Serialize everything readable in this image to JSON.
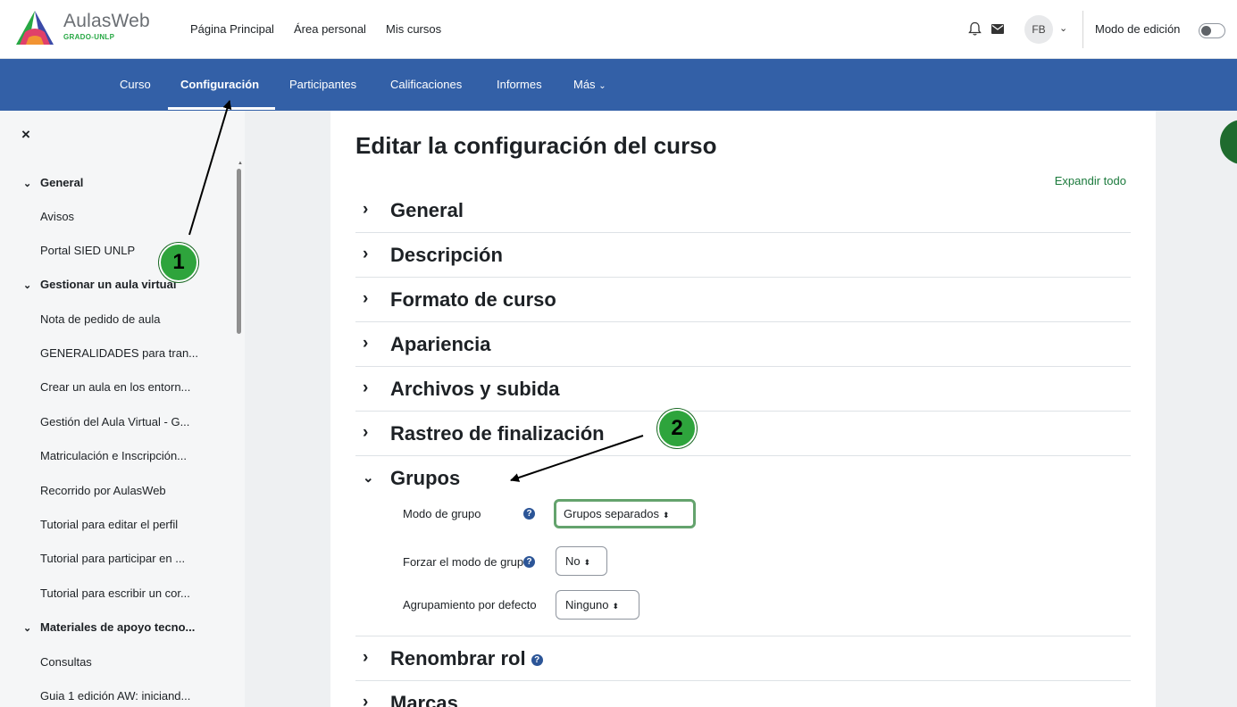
{
  "brand": {
    "name": "AulasWeb",
    "subtitle": "GRADO-UNLP"
  },
  "topnav": {
    "links": [
      "Página Principal",
      "Área personal",
      "Mis cursos"
    ]
  },
  "user": {
    "initials": "FB",
    "edit_mode_label": "Modo de edición",
    "edit_mode_on": false
  },
  "tabs": [
    "Curso",
    "Configuración",
    "Participantes",
    "Calificaciones",
    "Informes",
    "Más"
  ],
  "active_tab": "Configuración",
  "drawer": {
    "close": "×",
    "items": [
      {
        "type": "heading",
        "label": "General"
      },
      {
        "type": "item",
        "label": "Avisos"
      },
      {
        "type": "item",
        "label": "Portal SIED UNLP"
      },
      {
        "type": "heading",
        "label": "Gestionar un aula virtual"
      },
      {
        "type": "item",
        "label": "Nota de pedido de aula"
      },
      {
        "type": "item",
        "label": "GENERALIDADES para tran..."
      },
      {
        "type": "item",
        "label": "Crear un aula en los entorn..."
      },
      {
        "type": "item",
        "label": "Gestión del Aula Virtual - G..."
      },
      {
        "type": "item",
        "label": "Matriculación e Inscripción..."
      },
      {
        "type": "item",
        "label": "Recorrido por AulasWeb"
      },
      {
        "type": "item",
        "label": "Tutorial para editar el perfil"
      },
      {
        "type": "item",
        "label": "Tutorial para participar en ..."
      },
      {
        "type": "item",
        "label": "Tutorial para escribir un cor..."
      },
      {
        "type": "heading",
        "label": "Materiales de apoyo tecno..."
      },
      {
        "type": "item",
        "label": "Consultas"
      },
      {
        "type": "item",
        "label": "Guia 1 edición AW: iniciand..."
      }
    ]
  },
  "main": {
    "title": "Editar la configuración del curso",
    "expand_all": "Expandir todo",
    "sections": [
      "General",
      "Descripción",
      "Formato de curso",
      "Apariencia",
      "Archivos y subida",
      "Rastreo de finalización",
      "Grupos",
      "Renombrar rol",
      "Marcas"
    ],
    "grupos": {
      "group_mode_label": "Modo de grupo",
      "group_mode_value": "Grupos separados",
      "force_label": "Forzar el modo de grupo",
      "force_value": "No",
      "grouping_label": "Agrupamiento por defecto",
      "grouping_value": "Ninguno"
    }
  },
  "annotations": [
    "1",
    "2"
  ],
  "icons": [
    "bell-icon",
    "mail-icon",
    "chevron-down-icon",
    "close-icon",
    "chevron-right-icon",
    "help-icon"
  ]
}
